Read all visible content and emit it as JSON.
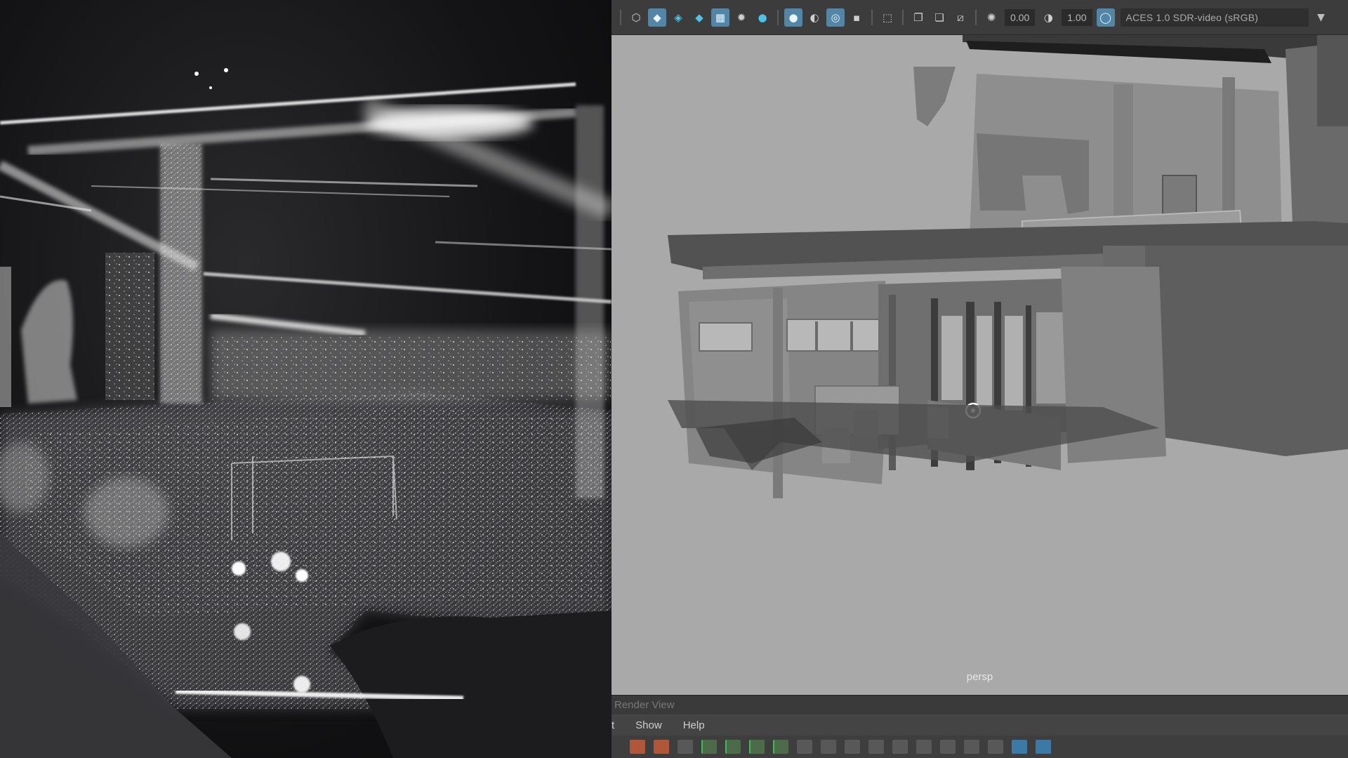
{
  "viewport_toolbar": {
    "exposure_value": "0.00",
    "gamma_value": "1.00",
    "color_space": "ACES 1.0 SDR-video (sRGB)"
  },
  "viewport": {
    "camera_label": "persp"
  },
  "render_view": {
    "title": "Render View",
    "menu": [
      "t",
      "Show",
      "Help"
    ]
  },
  "colors": {
    "toolbar_bg": "#3c3c3c",
    "active_button": "#5285a6",
    "viewport_bg": "#a9a9a9",
    "pointcloud_bg": "#141416"
  }
}
